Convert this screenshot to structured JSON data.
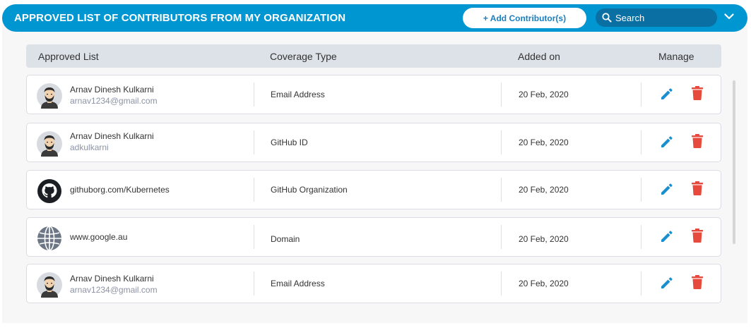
{
  "header": {
    "title": "APPROVED LIST OF CONTRIBUTORS FROM MY ORGANIZATION",
    "add_button_label": "+ Add Contributor(s)",
    "search_placeholder": "Search"
  },
  "columns": {
    "approved_list": "Approved List",
    "coverage_type": "Coverage Type",
    "added_on": "Added on",
    "manage": "Manage"
  },
  "rows": [
    {
      "name": "Arnav Dinesh Kulkarni",
      "sub": "arnav1234@gmail.com",
      "coverage": "Email Address",
      "date": "20 Feb, 2020",
      "icon": "person-avatar"
    },
    {
      "name": "Arnav Dinesh Kulkarni",
      "sub": "adkulkarni",
      "coverage": "GitHub ID",
      "date": "20 Feb, 2020",
      "icon": "person-avatar"
    },
    {
      "name": "githuborg.com/Kubernetes",
      "sub": "",
      "coverage": "GitHub Organization",
      "date": "20 Feb, 2020",
      "icon": "github-icon"
    },
    {
      "name": "www.google.au",
      "sub": "",
      "coverage": "Domain",
      "date": "20 Feb, 2020",
      "icon": "globe-icon"
    },
    {
      "name": "Arnav Dinesh Kulkarni",
      "sub": "arnav1234@gmail.com",
      "coverage": "Email Address",
      "date": "20 Feb, 2020",
      "icon": "person-avatar"
    }
  ],
  "colors": {
    "header_blue": "#0096d1",
    "search_bg": "#0a6fa3",
    "edit_blue": "#1a8fd0",
    "delete_red": "#e64a3c"
  }
}
